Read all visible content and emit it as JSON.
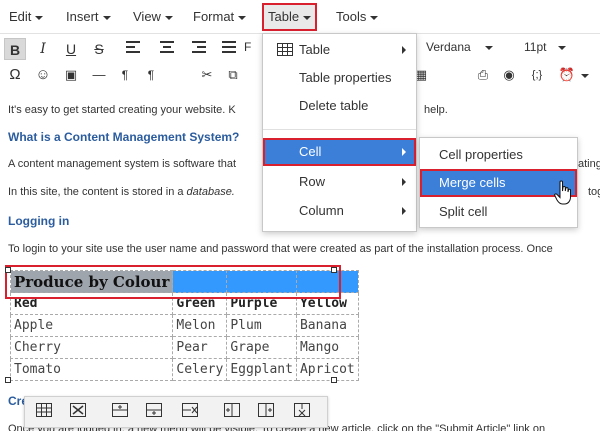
{
  "menubar": {
    "items": [
      {
        "label": "Edit"
      },
      {
        "label": "Insert"
      },
      {
        "label": "View"
      },
      {
        "label": "Format"
      },
      {
        "label": "Table"
      },
      {
        "label": "Tools"
      }
    ]
  },
  "toolbar": {
    "font_family": "Verdana",
    "font_size": "11pt",
    "partial_format_label": "F",
    "code_label": "{;}"
  },
  "content": {
    "intro": "It's easy to get started creating your website. K",
    "intro_tail": "help.",
    "h_cms": "What is a Content Management System?",
    "cms_text": "A content management system is software that",
    "cms_tail": "ating",
    "db_text_a": "In this site, the content is stored in a",
    "db_text_em": "database.",
    "db_tail": "tog",
    "h_login": "Logging in",
    "login_text": "To login to your site use the user name and password that were created as part of the installation process. Once",
    "h_create": "Cre",
    "bottom_text": "Once you are logged in, a new menu will be visible. To create a new article, click on the \"Submit Article\" link on"
  },
  "table": {
    "title": "Produce by Colour",
    "headers": [
      "Red",
      "Green",
      "Purple",
      "Yellow"
    ],
    "rows": [
      [
        "Apple",
        "Melon",
        "Plum",
        "Banana"
      ],
      [
        "Cherry",
        "Pear",
        "Grape",
        "Mango"
      ],
      [
        "Tomato",
        "Celery",
        "Eggplant",
        "Apricot"
      ]
    ]
  },
  "table_menu": {
    "items": [
      {
        "label": "Table"
      },
      {
        "label": "Table properties"
      },
      {
        "label": "Delete table"
      },
      {
        "label": "Cell"
      },
      {
        "label": "Row"
      },
      {
        "label": "Column"
      }
    ]
  },
  "cell_menu": {
    "items": [
      {
        "label": "Cell properties"
      },
      {
        "label": "Merge cells"
      },
      {
        "label": "Split cell"
      }
    ]
  },
  "colors": {
    "accent_red": "#d9202f",
    "highlight_blue": "#3b7fd9",
    "selection_blue": "#3399ff",
    "heading_blue": "#2b5c9e"
  }
}
